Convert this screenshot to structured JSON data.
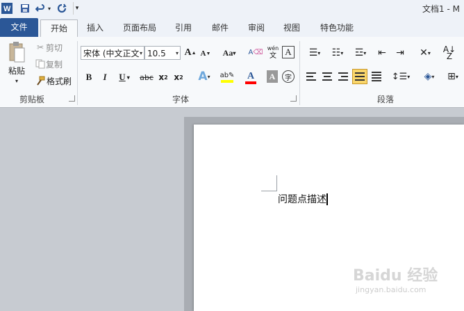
{
  "title": {
    "doc_name": "文档1 - M"
  },
  "tabs": [
    {
      "label": "文件"
    },
    {
      "label": "开始"
    },
    {
      "label": "插入"
    },
    {
      "label": "页面布局"
    },
    {
      "label": "引用"
    },
    {
      "label": "邮件"
    },
    {
      "label": "审阅"
    },
    {
      "label": "视图"
    },
    {
      "label": "特色功能"
    }
  ],
  "clipboard": {
    "paste": "粘贴",
    "cut": "剪切",
    "copy": "复制",
    "format_painter": "格式刷",
    "group_label": "剪贴板"
  },
  "font": {
    "family": "宋体 (中文正文)",
    "size": "10.5",
    "case_label": "Aa",
    "group_label": "字体"
  },
  "paragraph": {
    "group_label": "段落"
  },
  "document": {
    "text": "问题点描述"
  },
  "watermark": {
    "brand": "Baidu 经验",
    "url": "jingyan.baidu.com"
  },
  "colors": {
    "file_tab": "#2b5797",
    "highlight": "#ffff00",
    "font_color": "#ff0000",
    "active_align": "#f9d66b"
  }
}
